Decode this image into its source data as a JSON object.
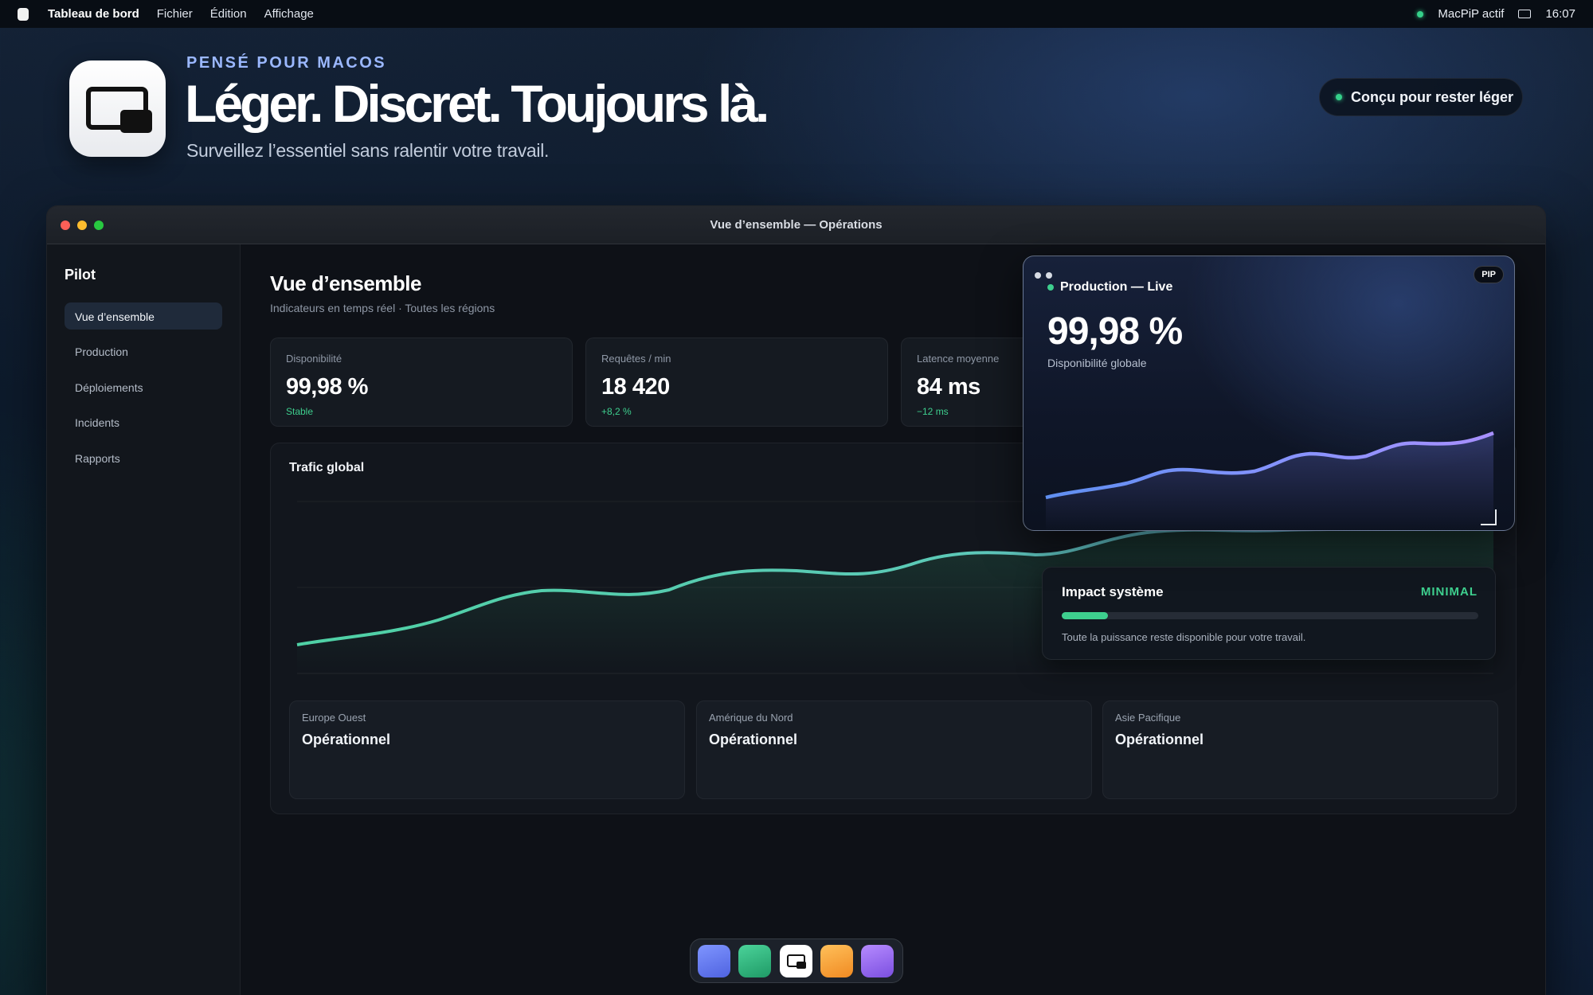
{
  "menubar": {
    "app_name": "Tableau de bord",
    "items": [
      "Fichier",
      "Édition",
      "Affichage"
    ],
    "status_text": "MacPiP actif",
    "clock": "16:07"
  },
  "hero": {
    "eyebrow": "PENSÉ POUR MACOS",
    "headline": "Léger. Discret. Toujours là.",
    "subline": "Surveillez l’essentiel sans ralentir votre travail.",
    "badge": "Conçu pour rester léger"
  },
  "window": {
    "title": "Vue d’ensemble — Opérations"
  },
  "sidebar": {
    "title": "Pilot",
    "items": [
      {
        "label": "Vue d’ensemble"
      },
      {
        "label": "Production"
      },
      {
        "label": "Déploiements"
      },
      {
        "label": "Incidents"
      },
      {
        "label": "Rapports"
      }
    ]
  },
  "overview": {
    "title": "Vue d’ensemble",
    "subtitle": "Indicateurs en temps réel · Toutes les régions"
  },
  "kpis": [
    {
      "label": "Disponibilité",
      "value": "99,98 %",
      "delta": "Stable"
    },
    {
      "label": "Requêtes / min",
      "value": "18 420",
      "delta": "+8,2 %"
    },
    {
      "label": "Latence moyenne",
      "value": "84 ms",
      "delta": "−12 ms"
    }
  ],
  "traffic": {
    "title": "Trafic global"
  },
  "regions": [
    {
      "name": "Europe Ouest",
      "status": "Opérationnel"
    },
    {
      "name": "Amérique du Nord",
      "status": "Opérationnel"
    },
    {
      "name": "Asie Pacifique",
      "status": "Opérationnel"
    }
  ],
  "impact": {
    "title": "Impact système",
    "level": "MINIMAL",
    "level_fraction": 0.11,
    "note": "Toute la puissance reste disponible pour votre travail."
  },
  "pip": {
    "title": "Production — Live",
    "badge": "PIP",
    "value": "99,98 %",
    "caption": "Disponibilité globale"
  },
  "colors": {
    "accent_green": "#3ecf8e",
    "pip_line": "#8b93ff",
    "traffic_line": "#4fd1a5"
  },
  "dock": {
    "apps": [
      "blue-app-icon",
      "green-app-icon",
      "macpip-app-icon",
      "orange-app-icon",
      "purple-app-icon"
    ]
  }
}
